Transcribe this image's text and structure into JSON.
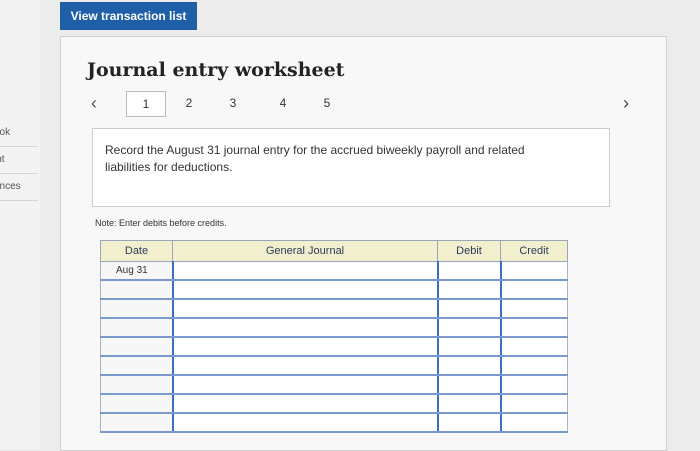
{
  "sidebar": {
    "items": [
      {
        "label": "ook"
      },
      {
        "label": "int"
      },
      {
        "label": "ences"
      }
    ]
  },
  "header": {
    "view_transactions_label": "View transaction list"
  },
  "worksheet": {
    "title": "Journal entry worksheet",
    "nav": {
      "prev_icon": "chevron-left-icon",
      "next_icon": "chevron-right-icon",
      "tabs": [
        "1",
        "2",
        "3",
        "4",
        "5"
      ],
      "active_tab": "1"
    },
    "instruction": "Record the August 31 journal entry for the accrued biweekly payroll and related liabilities for deductions.",
    "note": "Note: Enter debits before credits.",
    "table": {
      "columns": [
        "Date",
        "General Journal",
        "Debit",
        "Credit"
      ],
      "rows": [
        {
          "date": "Aug 31",
          "account": "",
          "debit": "",
          "credit": ""
        },
        {
          "date": "",
          "account": "",
          "debit": "",
          "credit": ""
        },
        {
          "date": "",
          "account": "",
          "debit": "",
          "credit": ""
        },
        {
          "date": "",
          "account": "",
          "debit": "",
          "credit": ""
        },
        {
          "date": "",
          "account": "",
          "debit": "",
          "credit": ""
        },
        {
          "date": "",
          "account": "",
          "debit": "",
          "credit": ""
        },
        {
          "date": "",
          "account": "",
          "debit": "",
          "credit": ""
        },
        {
          "date": "",
          "account": "",
          "debit": "",
          "credit": ""
        },
        {
          "date": "",
          "account": "",
          "debit": "",
          "credit": ""
        }
      ]
    }
  },
  "colors": {
    "button_bg": "#1f5fa8",
    "header_bg": "#f2efce",
    "row_border": "#3a6fc2"
  }
}
